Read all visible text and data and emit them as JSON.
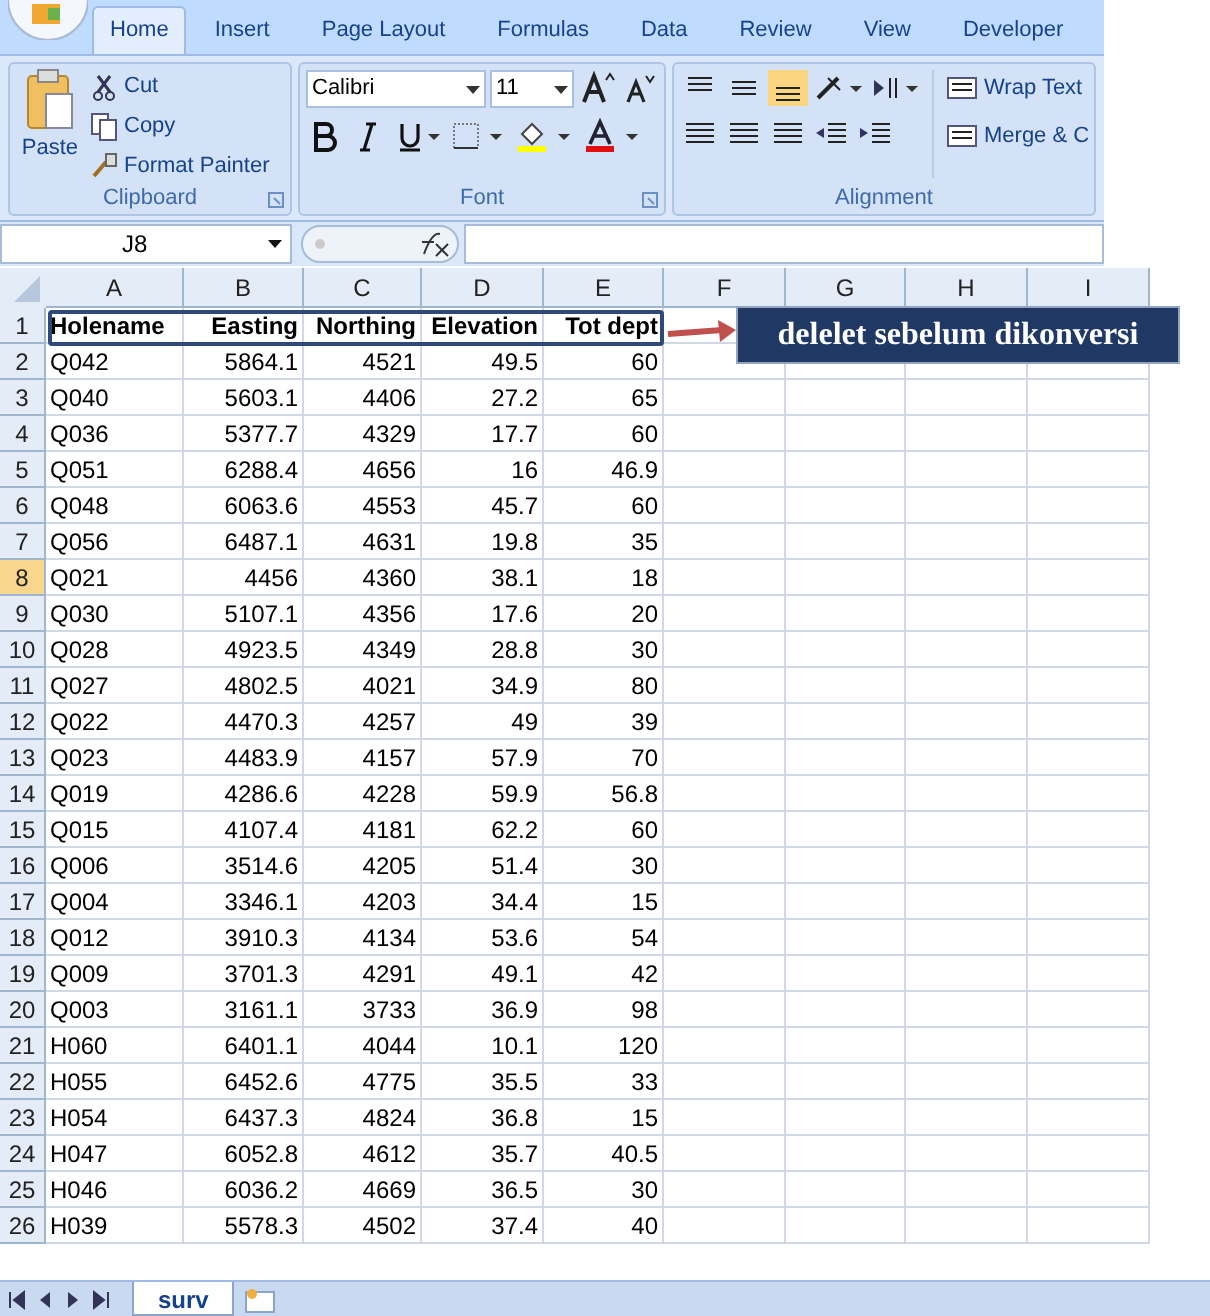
{
  "ribbon_tabs": [
    {
      "label": "Home",
      "selected": true
    },
    {
      "label": "Insert",
      "selected": false
    },
    {
      "label": "Page Layout",
      "selected": false
    },
    {
      "label": "Formulas",
      "selected": false
    },
    {
      "label": "Data",
      "selected": false
    },
    {
      "label": "Review",
      "selected": false
    },
    {
      "label": "View",
      "selected": false
    },
    {
      "label": "Developer",
      "selected": false
    }
  ],
  "clipboard": {
    "paste": "Paste",
    "cut": "Cut",
    "copy": "Copy",
    "format_painter": "Format Painter",
    "group_label": "Clipboard"
  },
  "font": {
    "family": "Calibri",
    "size": "11",
    "group_label": "Font"
  },
  "alignment": {
    "wrap_text": "Wrap Text",
    "merge": "Merge & C",
    "group_label": "Alignment"
  },
  "name_box": "J8",
  "columns": [
    {
      "label": "A",
      "selected": false
    },
    {
      "label": "B",
      "selected": false
    },
    {
      "label": "C",
      "selected": false
    },
    {
      "label": "D",
      "selected": false
    },
    {
      "label": "E",
      "selected": false
    },
    {
      "label": "F",
      "selected": false
    },
    {
      "label": "G",
      "selected": false
    },
    {
      "label": "H",
      "selected": false
    },
    {
      "label": "I",
      "selected": false
    }
  ],
  "rows": [
    {
      "number": "1",
      "selected": false,
      "cells": [
        "Holename",
        "Easting",
        "Northing",
        "Elevation",
        "Tot dept"
      ]
    },
    {
      "number": "2",
      "selected": false,
      "cells": [
        "Q042",
        "5864.1",
        "4521",
        "49.5",
        "60"
      ]
    },
    {
      "number": "3",
      "selected": false,
      "cells": [
        "Q040",
        "5603.1",
        "4406",
        "27.2",
        "65"
      ]
    },
    {
      "number": "4",
      "selected": false,
      "cells": [
        "Q036",
        "5377.7",
        "4329",
        "17.7",
        "60"
      ]
    },
    {
      "number": "5",
      "selected": false,
      "cells": [
        "Q051",
        "6288.4",
        "4656",
        "16",
        "46.9"
      ]
    },
    {
      "number": "6",
      "selected": false,
      "cells": [
        "Q048",
        "6063.6",
        "4553",
        "45.7",
        "60"
      ]
    },
    {
      "number": "7",
      "selected": false,
      "cells": [
        "Q056",
        "6487.1",
        "4631",
        "19.8",
        "35"
      ]
    },
    {
      "number": "8",
      "selected": true,
      "cells": [
        "Q021",
        "4456",
        "4360",
        "38.1",
        "18"
      ]
    },
    {
      "number": "9",
      "selected": false,
      "cells": [
        "Q030",
        "5107.1",
        "4356",
        "17.6",
        "20"
      ]
    },
    {
      "number": "10",
      "selected": false,
      "cells": [
        "Q028",
        "4923.5",
        "4349",
        "28.8",
        "30"
      ]
    },
    {
      "number": "11",
      "selected": false,
      "cells": [
        "Q027",
        "4802.5",
        "4021",
        "34.9",
        "80"
      ]
    },
    {
      "number": "12",
      "selected": false,
      "cells": [
        "Q022",
        "4470.3",
        "4257",
        "49",
        "39"
      ]
    },
    {
      "number": "13",
      "selected": false,
      "cells": [
        "Q023",
        "4483.9",
        "4157",
        "57.9",
        "70"
      ]
    },
    {
      "number": "14",
      "selected": false,
      "cells": [
        "Q019",
        "4286.6",
        "4228",
        "59.9",
        "56.8"
      ]
    },
    {
      "number": "15",
      "selected": false,
      "cells": [
        "Q015",
        "4107.4",
        "4181",
        "62.2",
        "60"
      ]
    },
    {
      "number": "16",
      "selected": false,
      "cells": [
        "Q006",
        "3514.6",
        "4205",
        "51.4",
        "30"
      ]
    },
    {
      "number": "17",
      "selected": false,
      "cells": [
        "Q004",
        "3346.1",
        "4203",
        "34.4",
        "15"
      ]
    },
    {
      "number": "18",
      "selected": false,
      "cells": [
        "Q012",
        "3910.3",
        "4134",
        "53.6",
        "54"
      ]
    },
    {
      "number": "19",
      "selected": false,
      "cells": [
        "Q009",
        "3701.3",
        "4291",
        "49.1",
        "42"
      ]
    },
    {
      "number": "20",
      "selected": false,
      "cells": [
        "Q003",
        "3161.1",
        "3733",
        "36.9",
        "98"
      ]
    },
    {
      "number": "21",
      "selected": false,
      "cells": [
        "H060",
        "6401.1",
        "4044",
        "10.1",
        "120"
      ]
    },
    {
      "number": "22",
      "selected": false,
      "cells": [
        "H055",
        "6452.6",
        "4775",
        "35.5",
        "33"
      ]
    },
    {
      "number": "23",
      "selected": false,
      "cells": [
        "H054",
        "6437.3",
        "4824",
        "36.8",
        "15"
      ]
    },
    {
      "number": "24",
      "selected": false,
      "cells": [
        "H047",
        "6052.8",
        "4612",
        "35.7",
        "40.5"
      ]
    },
    {
      "number": "25",
      "selected": false,
      "cells": [
        "H046",
        "6036.2",
        "4669",
        "36.5",
        "30"
      ]
    },
    {
      "number": "26",
      "selected": false,
      "cells": [
        "H039",
        "5578.3",
        "4502",
        "37.4",
        "40"
      ]
    }
  ],
  "annotation": "delelet sebelum dikonversi",
  "sheet_tabs": [
    {
      "label": "surv",
      "selected": true
    }
  ]
}
